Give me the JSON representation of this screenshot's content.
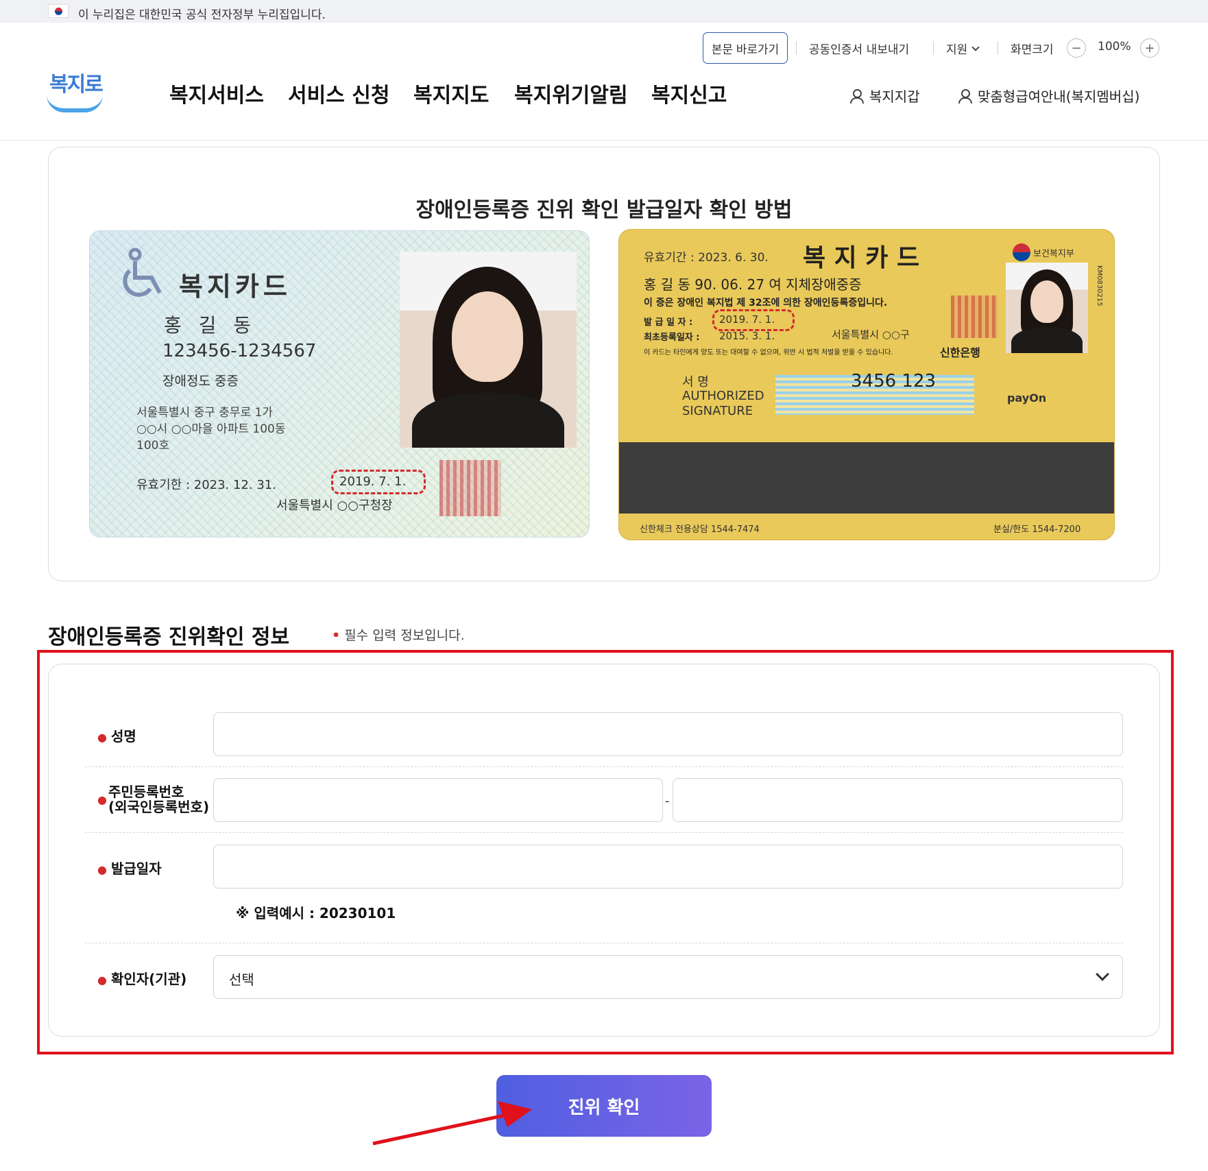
{
  "gov_banner": {
    "text": "이 누리집은 대한민국 공식 전자정부 누리집입니다."
  },
  "utility": {
    "skip": "본문 바로가기",
    "cert_export": "공동인증서 내보내기",
    "support": "지원",
    "screen_size": "화면크기",
    "zoom_minus": "−",
    "zoom_level": "100%",
    "zoom_plus": "+"
  },
  "logo": {
    "text": "복지로"
  },
  "gnb": [
    "복지서비스",
    "서비스 신청",
    "복지지도",
    "복지위기알림",
    "복지신고"
  ],
  "header_links": {
    "wallet": "복지지갑",
    "membership": "맞춤형급여안내(복지멤버십)"
  },
  "guide": {
    "title": "장애인등록증 진위 확인 발급일자 확인 방법",
    "card1": {
      "title": "복지카드",
      "name": "홍 길 동",
      "id_number": "123456-1234567",
      "grade": "장애정도 중증",
      "address_1": "서울특별시 중구 충무로 1가",
      "address_2": "○○시 ○○마을 아파트 100동",
      "address_3": "100호",
      "valid": "유효기한 : 2023. 12. 31.",
      "issue": "2019. 7. 1.",
      "issuer": "서울특별시 ○○구청장"
    },
    "card2": {
      "valid": "유효기간 :  2023.  6.  30.",
      "title": "복 지 카 드",
      "ministry": "보건복지부",
      "person": "홍 길 동   90. 06. 27  여  지체장애중증",
      "law": "이 증은 장애인 복지법 제 32조에 의한 장애인등록증입니다.",
      "issue_label": "발 급 일 자 :",
      "issue": "2019.  7.  1.",
      "first_label": "최초등록일자 :",
      "first": "2015.  3.  1.",
      "issuer": "서울특별시 ○○구",
      "notice": "이 카드는 타인에게 양도 또는 대여할 수 없으며, 위반 시 법적 처벌을 받을 수 있습니다.",
      "bank": "신한은행",
      "sign_kr": "서        명",
      "sign_1": "AUTHORIZED",
      "sign_2": "SIGNATURE",
      "card_no": "3456 123",
      "payon": "payOn",
      "serial": "KM0830215",
      "hotline_1": "신한체크 전용상담 1544-7474",
      "hotline_2": "분실/한도 1544-7200"
    }
  },
  "section": {
    "title": "장애인등록증 진위확인 정보",
    "required_note": "필수 입력 정보입니다."
  },
  "form": {
    "name_label": "성명",
    "name_value": "",
    "rrn_label_1": "주민등록번호",
    "rrn_label_2": "(외국인등록번호)",
    "rrn_front": "",
    "rrn_sep": "-",
    "rrn_back": "",
    "issue_label": "발급일자",
    "issue_value": "",
    "hint": "※ 입력예시 : 20230101",
    "verifier_label": "확인자(기관)",
    "verifier_selected": "선택"
  },
  "submit": {
    "label": "진위 확인"
  },
  "colors": {
    "accent": "#5a5fe0",
    "highlight": "#e0111b",
    "required": "#d42a2a"
  }
}
